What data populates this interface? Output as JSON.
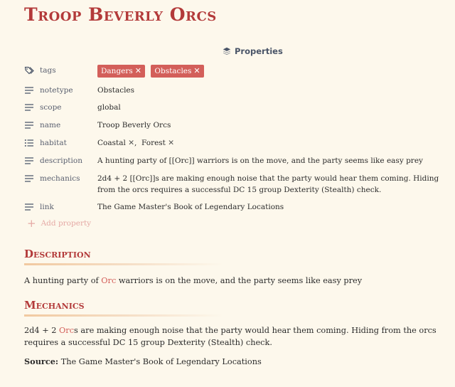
{
  "page": {
    "title": "Troop Beverly Orcs"
  },
  "properties": {
    "header_label": "Properties",
    "tags": {
      "key": "tags",
      "values": [
        "Dangers",
        "Obstacles"
      ]
    },
    "notetype": {
      "key": "notetype",
      "value": "Obstacles"
    },
    "scope": {
      "key": "scope",
      "value": "global"
    },
    "name": {
      "key": "name",
      "value": "Troop Beverly Orcs"
    },
    "habitat": {
      "key": "habitat",
      "values": [
        "Coastal",
        "Forest"
      ],
      "separator": ","
    },
    "description": {
      "key": "description",
      "value": "A hunting party of [[Orc]] warriors is on the move, and the party seems like easy prey"
    },
    "mechanics": {
      "key": "mechanics",
      "value": "2d4 + 2 [[Orc]]s are making enough noise that the party would hear them coming. Hiding from the orcs requires a successful DC 15 group Dexterity (Stealth) check."
    },
    "link": {
      "key": "link",
      "value": "The Game Master's Book of Legendary Locations"
    },
    "add_label": "Add property"
  },
  "description_section": {
    "heading": "Description",
    "before": "A hunting party of ",
    "link": "Orc",
    "after": " warriors is on the move, and the party seems like easy prey"
  },
  "mechanics_section": {
    "heading": "Mechanics",
    "before": "2d4 + 2 ",
    "link": "Orc",
    "after": "s are making enough noise that the party would hear them coming. Hiding from the orcs requires a successful DC 15 group Dexterity (Stealth) check.",
    "source_label": "Source:",
    "source_value": "The Game Master's Book of Legendary Locations"
  },
  "colors": {
    "accent": "#b33a3a",
    "tag_bg": "#d35f5a",
    "background": "#fdf8ec"
  },
  "icons": {
    "properties": "layers-icon",
    "tags": "tags-icon",
    "text": "text-lines-icon",
    "list": "list-icon",
    "add": "plus-icon",
    "remove": "x-icon"
  }
}
